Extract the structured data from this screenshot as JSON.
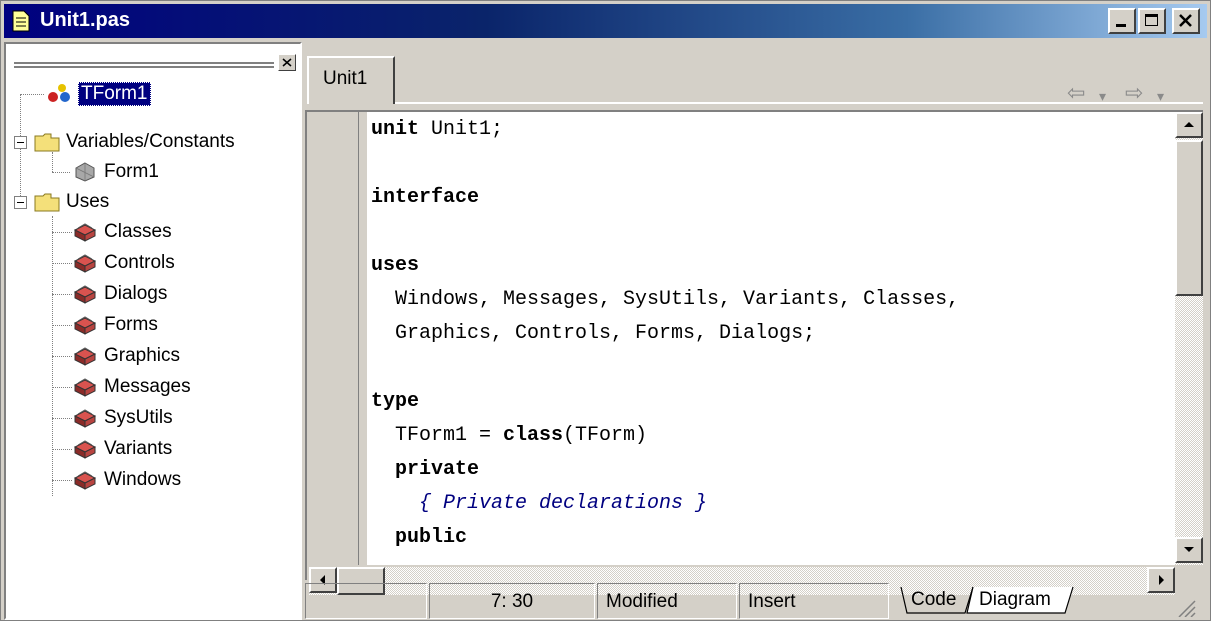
{
  "window": {
    "title": "Unit1.pas"
  },
  "explorer": {
    "root": {
      "label": "TForm1"
    },
    "variables": {
      "label": "Variables/Constants",
      "items": [
        "Form1"
      ]
    },
    "uses": {
      "label": "Uses",
      "items": [
        "Classes",
        "Controls",
        "Dialogs",
        "Forms",
        "Graphics",
        "Messages",
        "SysUtils",
        "Variants",
        "Windows"
      ]
    }
  },
  "editor": {
    "tab": "Unit1",
    "code": {
      "l1_kw": "unit",
      "l1_rest": " Unit1;",
      "l2_kw": "interface",
      "l3_kw": "uses",
      "l4": "  Windows, Messages, SysUtils, Variants, Classes,",
      "l5": "  Graphics, Controls, Forms, Dialogs;",
      "l6_kw": "type",
      "l7_a": "  TForm1 = ",
      "l7_kw": "class",
      "l7_b": "(TForm)",
      "l8_kw": "  private",
      "l9": "    { Private declarations }",
      "l10_kw": "  public"
    }
  },
  "statusbar": {
    "position": "7: 30",
    "modified": "Modified",
    "mode": "Insert",
    "tabs": [
      "Code",
      "Diagram"
    ]
  }
}
